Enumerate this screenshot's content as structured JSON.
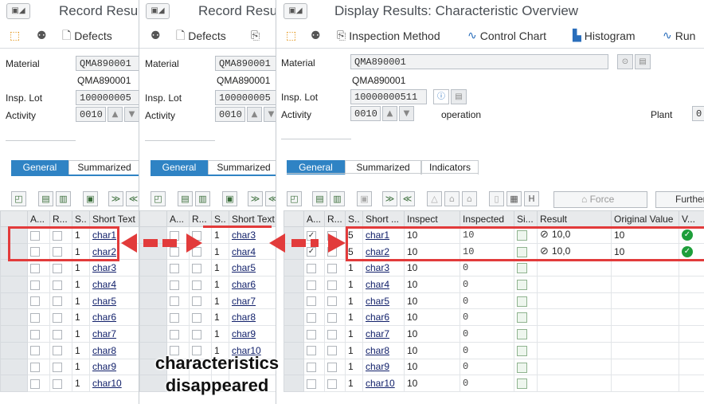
{
  "panels": {
    "p1": {
      "title": "Record Resu",
      "toolbar": {
        "defects": "Defects"
      },
      "fields": {
        "material_label": "Material",
        "material_value": "QMA890001",
        "material_text": "QMA890001",
        "lot_label": "Insp. Lot",
        "lot_value": "100000005",
        "activity_label": "Activity",
        "activity_value": "0010"
      },
      "tabs": [
        "General",
        "Summarized"
      ],
      "columns": [
        "A...",
        "R...",
        "S..",
        "Short Text"
      ],
      "rows": [
        {
          "s": "1",
          "text": "char1"
        },
        {
          "s": "1",
          "text": "char2"
        },
        {
          "s": "1",
          "text": "char3"
        },
        {
          "s": "1",
          "text": "char4"
        },
        {
          "s": "1",
          "text": "char5"
        },
        {
          "s": "1",
          "text": "char6"
        },
        {
          "s": "1",
          "text": "char7"
        },
        {
          "s": "1",
          "text": "char8"
        },
        {
          "s": "1",
          "text": "char9"
        },
        {
          "s": "1",
          "text": "char10"
        }
      ]
    },
    "p2": {
      "title": "Record Resu",
      "toolbar": {
        "defects": "Defects"
      },
      "fields": {
        "material_label": "Material",
        "material_value": "QMA890001",
        "material_text": "QMA890001",
        "lot_label": "Insp. Lot",
        "lot_value": "100000005",
        "activity_label": "Activity",
        "activity_value": "0010"
      },
      "tabs": [
        "General",
        "Summarized"
      ],
      "columns": [
        "A...",
        "R...",
        "S..",
        "Short Text"
      ],
      "rows": [
        {
          "s": "1",
          "text": "char3"
        },
        {
          "s": "1",
          "text": "char4"
        },
        {
          "s": "1",
          "text": "char5"
        },
        {
          "s": "1",
          "text": "char6"
        },
        {
          "s": "1",
          "text": "char7"
        },
        {
          "s": "1",
          "text": "char8"
        },
        {
          "s": "1",
          "text": "char9"
        },
        {
          "s": "1",
          "text": "char10"
        },
        {
          "s": "",
          "text": ""
        },
        {
          "s": "",
          "text": ""
        }
      ]
    },
    "p3": {
      "title": "Display Results: Characteristic Overview",
      "toolbar": {
        "insp_method": "Inspection Method",
        "control_chart": "Control Chart",
        "histogram": "Histogram",
        "run": "Run"
      },
      "fields": {
        "material_label": "Material",
        "material_value": "QMA890001",
        "material_text": "QMA890001",
        "lot_label": "Insp. Lot",
        "lot_value": "10000000511",
        "activity_label": "Activity",
        "activity_value": "0010",
        "activity_text": "operation",
        "plant_label": "Plant",
        "plant_value": "0"
      },
      "tabs": [
        "General",
        "Summarized",
        "Indicators"
      ],
      "grid_buttons": {
        "force": "Force",
        "further": "Further"
      },
      "columns": [
        "A...",
        "R...",
        "S..",
        "Short ...",
        "Inspect",
        "Inspected",
        "Si...",
        "Result",
        "Original Value",
        "V..."
      ],
      "rows": [
        {
          "a": "✓",
          "s": "5",
          "text": "char1",
          "inspect": "10",
          "inspected": "10",
          "result": "10,0",
          "orig": "10",
          "valid": true
        },
        {
          "a": "✓",
          "s": "5",
          "text": "char2",
          "inspect": "10",
          "inspected": "10",
          "result": "10,0",
          "orig": "10",
          "valid": true
        },
        {
          "a": "",
          "s": "1",
          "text": "char3",
          "inspect": "10",
          "inspected": "0",
          "result": "",
          "orig": "",
          "valid": false
        },
        {
          "a": "",
          "s": "1",
          "text": "char4",
          "inspect": "10",
          "inspected": "0",
          "result": "",
          "orig": "",
          "valid": false
        },
        {
          "a": "",
          "s": "1",
          "text": "char5",
          "inspect": "10",
          "inspected": "0",
          "result": "",
          "orig": "",
          "valid": false
        },
        {
          "a": "",
          "s": "1",
          "text": "char6",
          "inspect": "10",
          "inspected": "0",
          "result": "",
          "orig": "",
          "valid": false
        },
        {
          "a": "",
          "s": "1",
          "text": "char7",
          "inspect": "10",
          "inspected": "0",
          "result": "",
          "orig": "",
          "valid": false
        },
        {
          "a": "",
          "s": "1",
          "text": "char8",
          "inspect": "10",
          "inspected": "0",
          "result": "",
          "orig": "",
          "valid": false
        },
        {
          "a": "",
          "s": "1",
          "text": "char9",
          "inspect": "10",
          "inspected": "0",
          "result": "",
          "orig": "",
          "valid": false
        },
        {
          "a": "",
          "s": "1",
          "text": "char10",
          "inspect": "10",
          "inspected": "0",
          "result": "",
          "orig": "",
          "valid": false
        }
      ]
    }
  },
  "annotation": {
    "line1": "characteristics",
    "line2": "disappeared",
    "color": "#e23b3b"
  }
}
